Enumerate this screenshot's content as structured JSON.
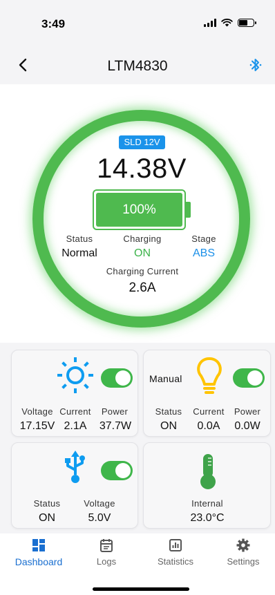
{
  "status_bar": {
    "time": "3:49"
  },
  "header": {
    "title": "LTM4830"
  },
  "battery": {
    "type_badge": "SLD 12V",
    "voltage": "14.38V",
    "percent_label": "100%",
    "percent": 100,
    "status_label": "Status",
    "status_value": "Normal",
    "charging_label": "Charging",
    "charging_value": "ON",
    "stage_label": "Stage",
    "stage_value": "ABS",
    "current_label": "Charging Current",
    "current_value": "2.6A"
  },
  "solar": {
    "toggle_on": true,
    "voltage_label": "Voltage",
    "voltage_value": "17.15V",
    "current_label": "Current",
    "current_value": "2.1A",
    "power_label": "Power",
    "power_value": "37.7W"
  },
  "light": {
    "mode": "Manual",
    "toggle_on": true,
    "status_label": "Status",
    "status_value": "ON",
    "current_label": "Current",
    "current_value": "0.0A",
    "power_label": "Power",
    "power_value": "0.0W"
  },
  "usb": {
    "toggle_on": true,
    "status_label": "Status",
    "status_value": "ON",
    "voltage_label": "Voltage",
    "voltage_value": "5.0V"
  },
  "temperature": {
    "label": "Internal",
    "value": "23.0°C"
  },
  "nav": {
    "items": [
      {
        "label": "Dashboard",
        "icon": "dashboard-icon"
      },
      {
        "label": "Logs",
        "icon": "calendar-icon"
      },
      {
        "label": "Statistics",
        "icon": "chart-icon"
      },
      {
        "label": "Settings",
        "icon": "gear-icon"
      }
    ],
    "active_index": 0
  },
  "colors": {
    "accent_green": "#4fba4f",
    "accent_blue": "#1a93ea",
    "accent_orange": "#f5a800",
    "nav_active": "#1a6fd0"
  }
}
